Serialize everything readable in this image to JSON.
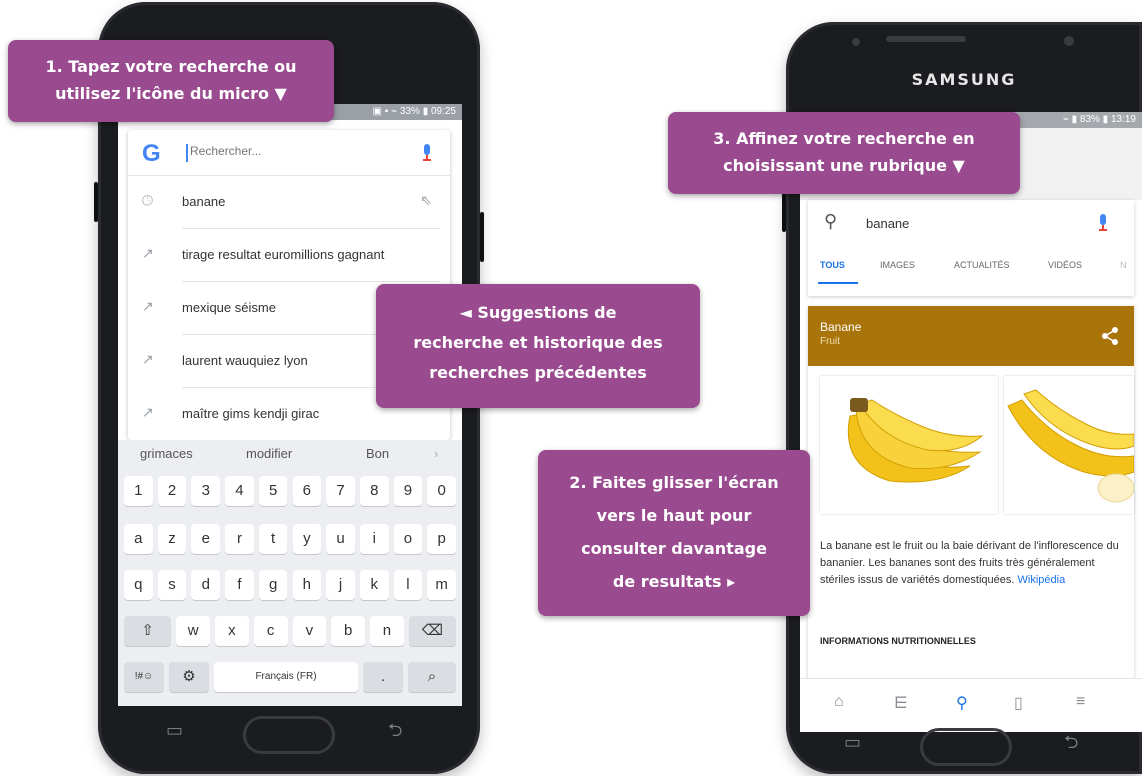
{
  "left_phone": {
    "status": "▣ ▪ ⌁ 33% ▮ 09:25",
    "search": {
      "logo": "G",
      "placeholder": "Rechercher..."
    },
    "suggestions": [
      {
        "icon": "history-icon",
        "text": "banane"
      },
      {
        "icon": "trending-icon",
        "text": "tirage resultat euromillions gagnant"
      },
      {
        "icon": "trending-icon",
        "text": "mexique séisme"
      },
      {
        "icon": "trending-icon",
        "text": "laurent wauquiez lyon"
      },
      {
        "icon": "trending-icon",
        "text": "maître gims kendji girac"
      }
    ],
    "keyboard": {
      "words": [
        "grimaces",
        "modifier",
        "Bon",
        "›"
      ],
      "row_numbers": [
        "1",
        "2",
        "3",
        "4",
        "5",
        "6",
        "7",
        "8",
        "9",
        "0"
      ],
      "row1": [
        "a",
        "z",
        "e",
        "r",
        "t",
        "y",
        "u",
        "i",
        "o",
        "p"
      ],
      "row2": [
        "q",
        "s",
        "d",
        "f",
        "g",
        "h",
        "j",
        "k",
        "l",
        "m"
      ],
      "row3": [
        "⇧",
        "w",
        "x",
        "c",
        "v",
        "b",
        "n",
        "⌫"
      ],
      "row4": [
        "!#☺",
        "⚙",
        "Français (FR)",
        ".",
        "⌕"
      ]
    }
  },
  "right_phone": {
    "brand": "SAMSUNG",
    "status": "⌁ ▮ 83% ▮ 13:19",
    "search_text": "banane",
    "tabs": [
      "TOUS",
      "IMAGES",
      "ACTUALITÉS",
      "VIDÉOS",
      "N"
    ],
    "knowledge_panel": {
      "title": "Banane",
      "subtitle": "Fruit",
      "description": "La banane est le fruit ou la baie dérivant de l'inflorescence du bananier. Les bananes sont des fruits très généralement stériles issus de variétés domestiquées.",
      "source_link": "Wikipédia",
      "section_heading": "INFORMATIONS NUTRITIONNELLES"
    }
  },
  "callouts": {
    "c1": [
      "1. Tapez votre recherche ou",
      "utilisez l'icône du micro ▼"
    ],
    "c2": [
      "◄ Suggestions de",
      "recherche et historique des",
      "recherches précédentes"
    ],
    "c3": [
      "3. Affinez votre recherche en",
      "choisissant une rubrique ▼"
    ],
    "c4": [
      "2. Faites glisser l'écran",
      "vers le haut pour",
      "consulter davantage",
      "de resultats ▸"
    ]
  },
  "colors": {
    "callout": "#9a4a8f",
    "kp_header": "#a9750a",
    "accent": "#1a73e8"
  }
}
